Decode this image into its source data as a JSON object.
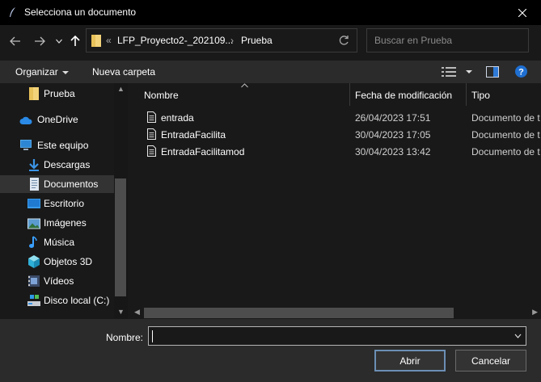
{
  "window": {
    "title": "Selecciona un documento"
  },
  "address": {
    "prefix": "«",
    "crumbs": [
      "LFP_Proyecto2-_202109...",
      "Prueba"
    ],
    "separator": "›"
  },
  "search": {
    "placeholder": "Buscar en Prueba"
  },
  "toolbar": {
    "organize_label": "Organizar",
    "new_folder_label": "Nueva carpeta"
  },
  "sidebar": {
    "items": [
      {
        "label": "Prueba",
        "icon": "folder-icon"
      },
      {
        "label": "OneDrive",
        "icon": "cloud-icon"
      },
      {
        "label": "Este equipo",
        "icon": "computer-icon"
      },
      {
        "label": "Descargas",
        "icon": "download-icon"
      },
      {
        "label": "Documentos",
        "icon": "documents-icon",
        "selected": true
      },
      {
        "label": "Escritorio",
        "icon": "desktop-icon"
      },
      {
        "label": "Imágenes",
        "icon": "images-icon"
      },
      {
        "label": "Música",
        "icon": "music-icon"
      },
      {
        "label": "Objetos 3D",
        "icon": "cube-icon"
      },
      {
        "label": "Vídeos",
        "icon": "video-icon"
      },
      {
        "label": "Disco local (C:)",
        "icon": "disk-icon"
      }
    ]
  },
  "columns": {
    "name": "Nombre",
    "date": "Fecha de modificación",
    "type": "Tipo"
  },
  "files": [
    {
      "name": "entrada",
      "date": "26/04/2023 17:51",
      "type": "Documento de t"
    },
    {
      "name": "EntradaFacilita",
      "date": "30/04/2023 17:05",
      "type": "Documento de t"
    },
    {
      "name": "EntradaFacilitamod",
      "date": "30/04/2023 13:42",
      "type": "Documento de t"
    }
  ],
  "footer": {
    "name_label": "Nombre:",
    "name_value": "",
    "open_label": "Abrir",
    "cancel_label": "Cancelar"
  },
  "colors": {
    "accent": "#0078d7",
    "folder": "#f3d37a",
    "background": "#191919"
  }
}
